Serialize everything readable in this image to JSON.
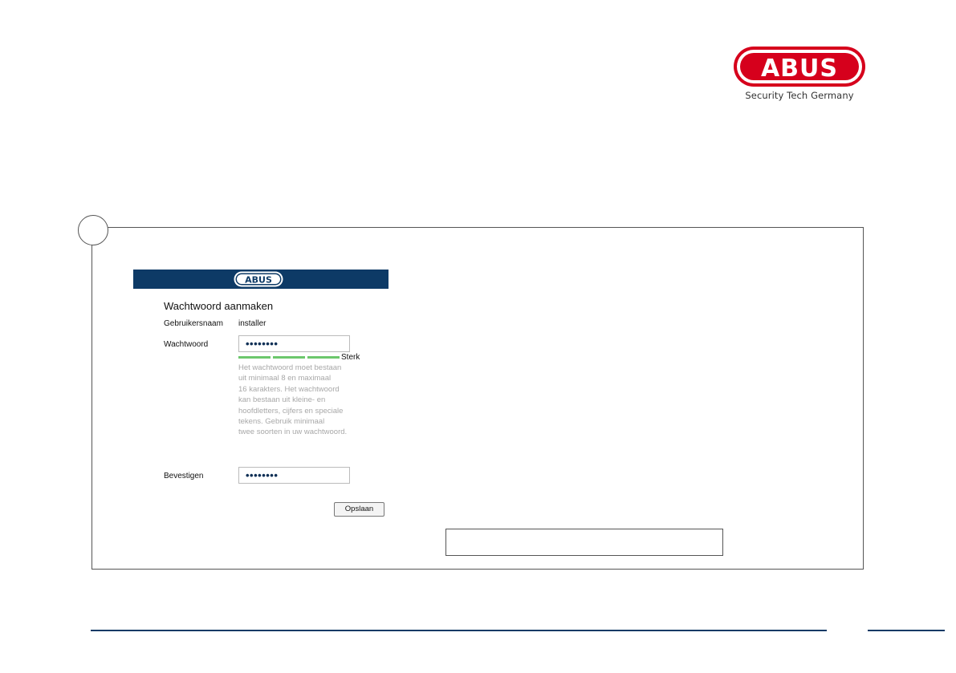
{
  "brand": {
    "logo_text": "ABUS",
    "tagline": "Security Tech Germany",
    "colors": {
      "red": "#d6001c",
      "navy": "#0d3a66"
    }
  },
  "form": {
    "heading": "Wachtwoord aanmaken",
    "username_label": "Gebruikersnaam",
    "username_value": "installer",
    "password_label": "Wachtwoord",
    "password_value": "••••••••",
    "strength": {
      "label": "Sterk",
      "segments_filled": 3,
      "segments_total": 3,
      "color": "#6cc76c"
    },
    "hint_lines": [
      "Het wachtwoord moet bestaan",
      "uit minimaal 8 en maximaal",
      "16 karakters. Het wachtwoord",
      "kan bestaan uit kleine- en",
      "hoofdletters, cijfers en speciale",
      "tekens. Gebruik minimaal",
      "twee soorten in uw wachtwoord."
    ],
    "confirm_label": "Bevestigen",
    "confirm_value": "••••••••",
    "save_label": "Opslaan"
  },
  "icons": {
    "step_marker": "circle",
    "brand_logo": "abus-logo"
  }
}
